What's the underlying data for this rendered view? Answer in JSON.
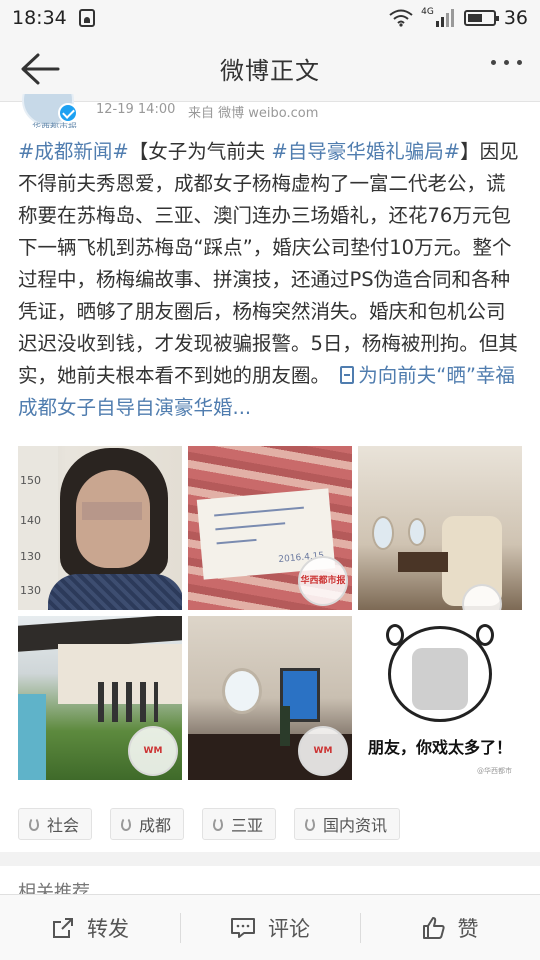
{
  "status_bar": {
    "time": "18:34",
    "network": "4G",
    "battery": "36"
  },
  "nav": {
    "title": "微博正文"
  },
  "post": {
    "time": "12-19 14:00",
    "source": "来自 微博 weibo.com",
    "avatar_text": "华西都市报",
    "text": {
      "hashtag1": "#成都新闻#",
      "seg1": "【女子为气前夫 ",
      "hashtag2": "#自导豪华婚礼骗局#",
      "seg2": "】因见不得前夫秀恩爱，成都女子杨梅虚构了一富二代老公，谎称要在苏梅岛、三亚、澳门连办三场婚礼，还花76万元包下一辆飞机到苏梅岛“踩点”，婚庆公司垫付10万元。整个过程中，杨梅编故事、拼演技，还通过PS伪造合同和各种凭证，晒够了朋友圈后，杨梅突然消失。婚庆和包机公司迟迟没收到钱，才发现被骗报警。5日，杨梅被刑拘。但其实，她前夫根本看不到她的朋友圈。",
      "link": "为向前夫“晒”幸福 成都女子自导自演豪华婚..."
    }
  },
  "images": {
    "ruler_marks": [
      "150",
      "140",
      "130",
      "130"
    ],
    "paper_date": "2016.4.15",
    "watermark": "华西都市报",
    "watermark_small": "WM",
    "meme_caption": "朋友，你戏太多了！",
    "meme_small": "@华西都市"
  },
  "tags": [
    "社会",
    "成都",
    "三亚",
    "国内资讯"
  ],
  "related": {
    "title": "相关推荐"
  },
  "bottom_bar": {
    "repost": "转发",
    "comment": "评论",
    "like": "赞"
  }
}
